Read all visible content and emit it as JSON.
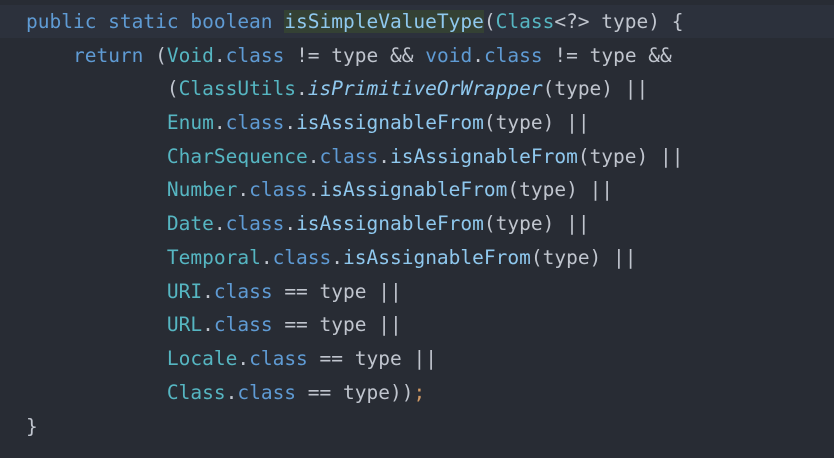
{
  "lines": [
    {
      "segments": [
        {
          "text": "public static boolean ",
          "kind": "keyword"
        },
        {
          "text": "isSimpleValueType",
          "kind": "method-decl"
        },
        {
          "text": "(",
          "kind": "punct"
        },
        {
          "text": "Class",
          "kind": "class"
        },
        {
          "text": "<?> type) {",
          "kind": "plain"
        }
      ]
    },
    {
      "segments": [
        {
          "text": "    ",
          "kind": "plain"
        },
        {
          "text": "return",
          "kind": "keyword"
        },
        {
          "text": " (",
          "kind": "plain"
        },
        {
          "text": "Void",
          "kind": "class"
        },
        {
          "text": ".",
          "kind": "plain"
        },
        {
          "text": "class",
          "kind": "keyword"
        },
        {
          "text": " != type && ",
          "kind": "plain"
        },
        {
          "text": "void",
          "kind": "keyword"
        },
        {
          "text": ".",
          "kind": "plain"
        },
        {
          "text": "class",
          "kind": "keyword"
        },
        {
          "text": " != type &&",
          "kind": "plain"
        }
      ]
    },
    {
      "segments": [
        {
          "text": "            (",
          "kind": "plain"
        },
        {
          "text": "ClassUtils",
          "kind": "class"
        },
        {
          "text": ".",
          "kind": "plain"
        },
        {
          "text": "isPrimitiveOrWrapper",
          "kind": "static-method"
        },
        {
          "text": "(type) ||",
          "kind": "plain"
        }
      ]
    },
    {
      "segments": [
        {
          "text": "            ",
          "kind": "plain"
        },
        {
          "text": "Enum",
          "kind": "class"
        },
        {
          "text": ".",
          "kind": "plain"
        },
        {
          "text": "class",
          "kind": "keyword"
        },
        {
          "text": ".",
          "kind": "plain"
        },
        {
          "text": "isAssignableFrom",
          "kind": "method"
        },
        {
          "text": "(type) ||",
          "kind": "plain"
        }
      ]
    },
    {
      "segments": [
        {
          "text": "            ",
          "kind": "plain"
        },
        {
          "text": "CharSequence",
          "kind": "class"
        },
        {
          "text": ".",
          "kind": "plain"
        },
        {
          "text": "class",
          "kind": "keyword"
        },
        {
          "text": ".",
          "kind": "plain"
        },
        {
          "text": "isAssignableFrom",
          "kind": "method"
        },
        {
          "text": "(type) ||",
          "kind": "plain"
        }
      ]
    },
    {
      "segments": [
        {
          "text": "            ",
          "kind": "plain"
        },
        {
          "text": "Number",
          "kind": "class"
        },
        {
          "text": ".",
          "kind": "plain"
        },
        {
          "text": "class",
          "kind": "keyword"
        },
        {
          "text": ".",
          "kind": "plain"
        },
        {
          "text": "isAssignableFrom",
          "kind": "method"
        },
        {
          "text": "(type) ||",
          "kind": "plain"
        }
      ]
    },
    {
      "segments": [
        {
          "text": "            ",
          "kind": "plain"
        },
        {
          "text": "Date",
          "kind": "class"
        },
        {
          "text": ".",
          "kind": "plain"
        },
        {
          "text": "class",
          "kind": "keyword"
        },
        {
          "text": ".",
          "kind": "plain"
        },
        {
          "text": "isAssignableFrom",
          "kind": "method"
        },
        {
          "text": "(type) ||",
          "kind": "plain"
        }
      ]
    },
    {
      "segments": [
        {
          "text": "            ",
          "kind": "plain"
        },
        {
          "text": "Temporal",
          "kind": "class"
        },
        {
          "text": ".",
          "kind": "plain"
        },
        {
          "text": "class",
          "kind": "keyword"
        },
        {
          "text": ".",
          "kind": "plain"
        },
        {
          "text": "isAssignableFrom",
          "kind": "method"
        },
        {
          "text": "(type) ||",
          "kind": "plain"
        }
      ]
    },
    {
      "segments": [
        {
          "text": "            ",
          "kind": "plain"
        },
        {
          "text": "URI",
          "kind": "class"
        },
        {
          "text": ".",
          "kind": "plain"
        },
        {
          "text": "class",
          "kind": "keyword"
        },
        {
          "text": " == type ||",
          "kind": "plain"
        }
      ]
    },
    {
      "segments": [
        {
          "text": "            ",
          "kind": "plain"
        },
        {
          "text": "URL",
          "kind": "class"
        },
        {
          "text": ".",
          "kind": "plain"
        },
        {
          "text": "class",
          "kind": "keyword"
        },
        {
          "text": " == type ||",
          "kind": "plain"
        }
      ]
    },
    {
      "segments": [
        {
          "text": "            ",
          "kind": "plain"
        },
        {
          "text": "Locale",
          "kind": "class"
        },
        {
          "text": ".",
          "kind": "plain"
        },
        {
          "text": "class",
          "kind": "keyword"
        },
        {
          "text": " == type ||",
          "kind": "plain"
        }
      ]
    },
    {
      "segments": [
        {
          "text": "            ",
          "kind": "plain"
        },
        {
          "text": "Class",
          "kind": "class"
        },
        {
          "text": ".",
          "kind": "plain"
        },
        {
          "text": "class",
          "kind": "keyword"
        },
        {
          "text": " == type))",
          "kind": "plain"
        },
        {
          "text": ";",
          "kind": "semicolon"
        }
      ]
    },
    {
      "segments": [
        {
          "text": "}",
          "kind": "plain"
        }
      ]
    }
  ],
  "colors": {
    "background": "#282c34",
    "current_line": "#2c313c",
    "keyword": "#5f9bd4",
    "class": "#56b6c2",
    "method": "#8fc8ee",
    "plain": "#c0c5ce",
    "semicolon": "#d19a66",
    "method_decl_highlight": "#344134"
  }
}
